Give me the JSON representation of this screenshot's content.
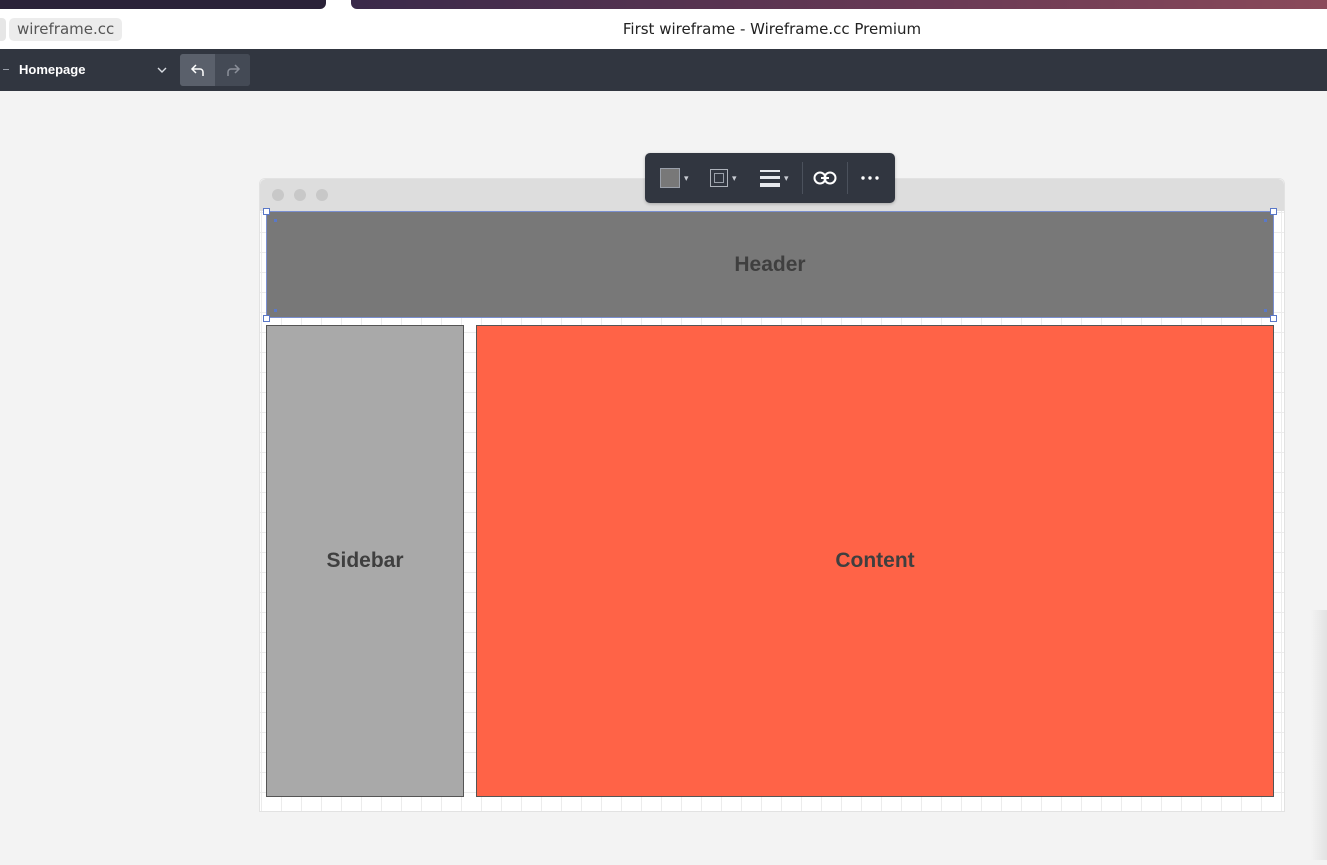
{
  "browser": {
    "domain": "wireframe.cc",
    "window_title": "First wireframe - Wireframe.cc Premium"
  },
  "toolbar": {
    "page_name": "Homepage",
    "undo_icon": "undo-icon",
    "redo_icon": "redo-icon"
  },
  "format_bar": {
    "fill_color": "#787878",
    "tools": [
      "fill-color",
      "border-style",
      "line-weight",
      "link",
      "more"
    ]
  },
  "canvas": {
    "header_label": "Header",
    "sidebar_label": "Sidebar",
    "content_label": "Content",
    "colors": {
      "header": "#787878",
      "sidebar": "#a9a9a9",
      "content": "#ff6347"
    }
  }
}
